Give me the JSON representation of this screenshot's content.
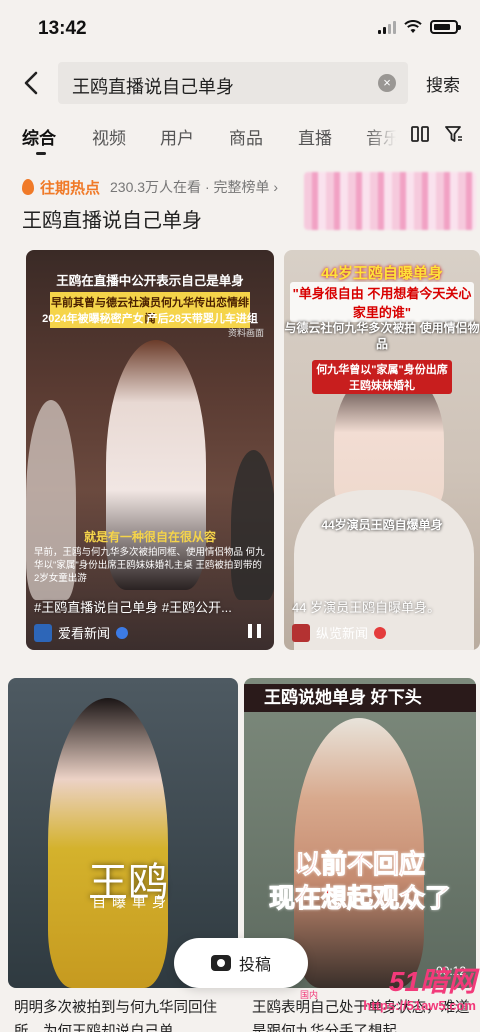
{
  "status_bar": {
    "time": "13:42"
  },
  "search": {
    "query": "王鸥直播说自己单身",
    "submit_label": "搜索"
  },
  "tabs": [
    "综合",
    "视频",
    "用户",
    "商品",
    "直播",
    "音乐"
  ],
  "hot": {
    "label": "往期热点",
    "count": "230.3万人在看 · 完整榜单 ›",
    "title": "王鸥直播说自己单身"
  },
  "cards": [
    {
      "captions": [
        "王鸥在直播中公开表示自己是单身",
        "早前其曾与德云社演员何九华传出恋情绯闻",
        "2024年被曝秘密产女 产后28天带婴儿车进组",
        "资料画面",
        "就是有一种很自在很从容",
        "早前，王鸥与何九华多次被拍同框、使用情侣物品 何九华以\"家属\"身份出席王鸥妹妹婚礼主桌 王鸥被拍到带的2岁女童出游"
      ],
      "title": "#王鸥直播说自己单身 #王鸥公开...",
      "source": "爱看新闻"
    },
    {
      "captions": [
        "44岁王鸥自曝单身",
        "\"单身很自由 不用想着今天关心家里的谁\"",
        "与德云社何九华多次被拍 使用情侣物品",
        "何九华曾以\"家属\"身份出席 王鸥妹妹婚礼",
        "44岁演员王鸥自爆单身"
      ],
      "title": "44 岁演员王鸥自曝单身。",
      "source": "纵览新闻"
    },
    {
      "captions": [
        "王鸥",
        "自曝单身"
      ],
      "text": "明明多次被拍到与何九华同回住所，为何王鸥却说自己单"
    },
    {
      "captions": [
        "王鸥说她单身 好下头",
        "以前不回应",
        "现在想起观众了"
      ],
      "duration": "00:12",
      "text": "王鸥表明自己处于单身状态，难道是跟何九华分手了想起"
    }
  ],
  "post_button": "投稿",
  "watermark": {
    "main": "51暗网",
    "url": "https://51aw5.com",
    "small": "国内"
  }
}
